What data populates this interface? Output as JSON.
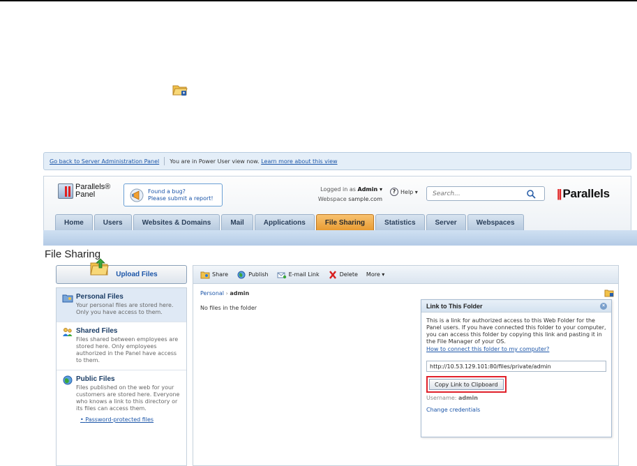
{
  "power_bar": {
    "back_link": "Go back to Server Administration Panel",
    "status_text": "You are in Power User view now.",
    "learn_link": "Learn more about this view"
  },
  "header": {
    "logo_line1": "Parallels®",
    "logo_line2": "Panel",
    "bug_line1": "Found a bug?",
    "bug_line2": "Please submit a report!",
    "logged_in_label": "Logged in as",
    "logged_in_user": "Admin ▾",
    "webspace_label": "Webspace",
    "webspace_value": "sample.com",
    "help_label": "Help ▾",
    "search_placeholder": "Search...",
    "brand": "Parallels",
    "brand_mark": "||"
  },
  "tabs": [
    {
      "label": "Home"
    },
    {
      "label": "Users"
    },
    {
      "label": "Websites & Domains"
    },
    {
      "label": "Mail"
    },
    {
      "label": "Applications"
    },
    {
      "label": "File Sharing"
    },
    {
      "label": "Statistics"
    },
    {
      "label": "Server"
    },
    {
      "label": "Webspaces"
    }
  ],
  "active_tab": "File Sharing",
  "page_title": "File Sharing",
  "upload_label": "Upload Files",
  "sidebar": {
    "items": [
      {
        "title": "Personal Files",
        "desc": "Your personal files are stored here. Only you have access to them."
      },
      {
        "title": "Shared Files",
        "desc": "Files shared between employees are stored here. Only employees authorized in the Panel have access to them."
      },
      {
        "title": "Public Files",
        "desc": "Files published on the web for your customers are stored here. Everyone who knows a link to this directory or its files can access them."
      }
    ],
    "protected_link": "Password-protected files"
  },
  "toolbar": {
    "share": "Share",
    "publish": "Publish",
    "email_link": "E-mail Link",
    "delete": "Delete",
    "more": "More ▾"
  },
  "breadcrumb": {
    "root": "Personal",
    "separator": "›",
    "current": "admin"
  },
  "empty_message": "No files in the folder",
  "popup": {
    "title": "Link to This Folder",
    "close_glyph": "×",
    "body": "This is a link for authorized access to this Web Folder for the Panel users. If you have connected this folder to your computer, you can access this folder by copying this link and pasting it in the File Manager of your OS.",
    "how_link": "How to connect this folder to my computer?",
    "url": "http://10.53.129.101:80/files/private/admin",
    "copy_button": "Copy Link to Clipboard",
    "username_label": "Username:",
    "username_value": "admin",
    "change_credentials": "Change credentials"
  },
  "colors": {
    "active_tab": "#e89a30",
    "link": "#1b55a8",
    "highlight_border": "#e0202a",
    "brand_red": "#e02020"
  }
}
